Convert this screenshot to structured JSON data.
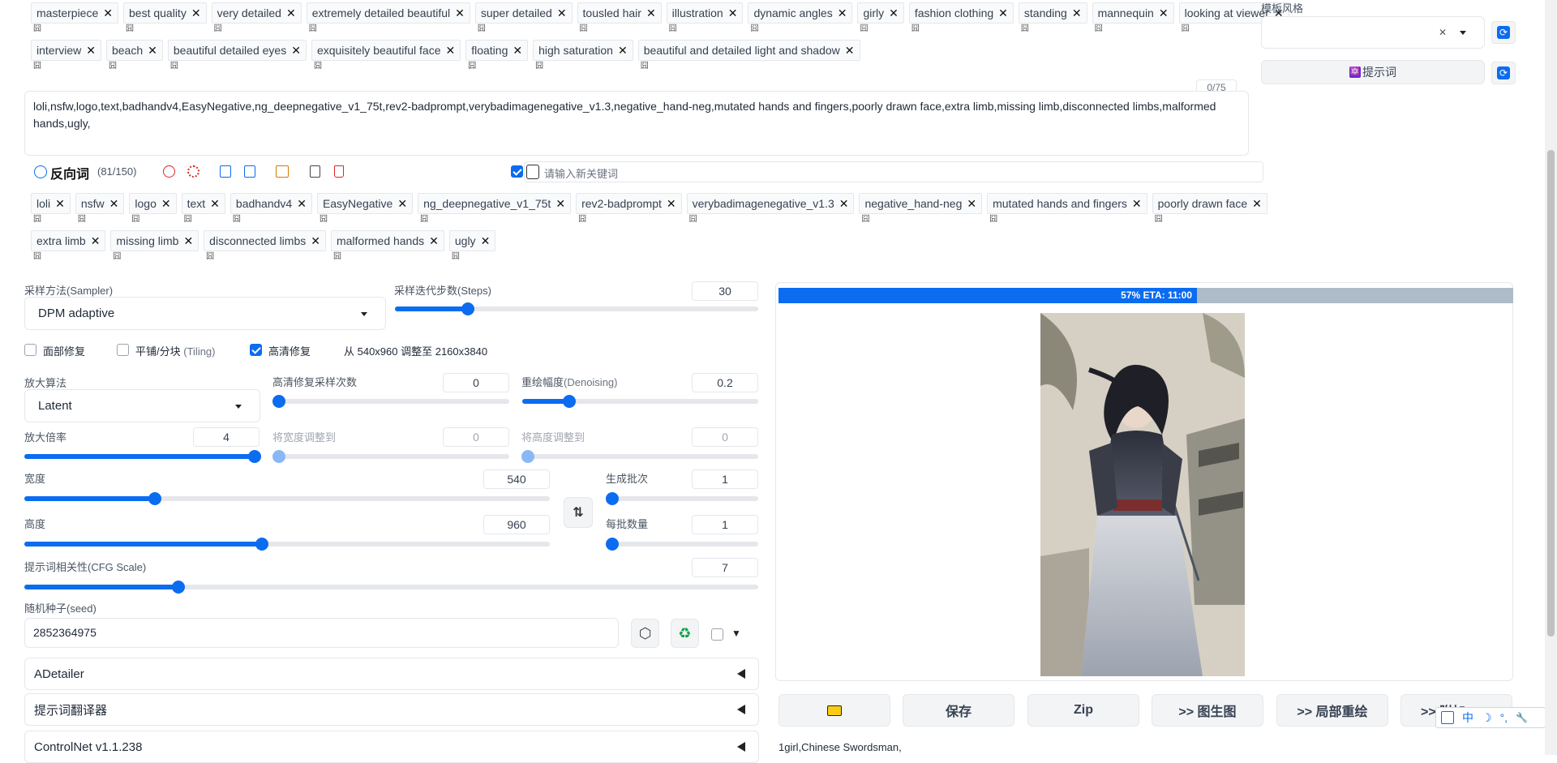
{
  "positive_tags": {
    "row1": [
      "masterpiece",
      "best quality",
      "very detailed",
      "extremely detailed beautiful",
      "super detailed",
      "tousled hair",
      "illustration",
      "dynamic angles",
      "girly",
      "fashion clothing",
      "standing",
      "mannequin",
      "looking at viewer"
    ],
    "row2": [
      "interview",
      "beach",
      "beautiful detailed eyes",
      "exquisitely beautiful face",
      "floating",
      "high saturation",
      "beautiful and detailed light and shadow"
    ],
    "sub_glyph": "囧",
    "remove_glyph": "✕"
  },
  "template": {
    "label": "模板风格",
    "clear_glyph": "✕",
    "prompt_button": "提示词",
    "prompt_icon_glyph": "🔯",
    "refresh_glyph": "⟳"
  },
  "token_counter": "0/75",
  "negative_text": "loli,nsfw,logo,text,badhandv4,EasyNegative,ng_deepnegative_v1_75t,rev2-badprompt,verybadimagenegative_v1.3,negative_hand-neg,mutated hands and fingers,poorly drawn face,extra limb,missing limb,disconnected limbs,malformed hands,ugly,",
  "negative_toolbar": {
    "title": "反向词",
    "count": "(81/150)",
    "keyword_placeholder": "请输入新关键词"
  },
  "negative_tags": {
    "row1": [
      "loli",
      "nsfw",
      "logo",
      "text",
      "badhandv4",
      "EasyNegative",
      "ng_deepnegative_v1_75t",
      "rev2-badprompt",
      "verybadimagenegative_v1.3",
      "negative_hand-neg",
      "mutated hands and fingers",
      "poorly drawn face"
    ],
    "row2": [
      "extra limb",
      "missing limb",
      "disconnected limbs",
      "malformed hands",
      "ugly"
    ]
  },
  "sampler": {
    "label": "采样方法(Sampler)",
    "value": "DPM adaptive"
  },
  "steps": {
    "label": "采样迭代步数(Steps)",
    "value": "30",
    "fraction": 0.2
  },
  "checkboxes": {
    "face_restore": "面部修复",
    "tiling": "平铺/分块",
    "tiling_en": "(Tiling)",
    "hires": "高清修复",
    "hires_info": "从 540x960 调整至 2160x3840"
  },
  "upscaler": {
    "label": "放大算法",
    "value": "Latent"
  },
  "hires_steps": {
    "label": "高清修复采样次数",
    "value": "0",
    "fraction": 0.0
  },
  "denoising": {
    "label": "重绘幅度",
    "label_en": "(Denoising)",
    "value": "0.2",
    "fraction": 0.2
  },
  "upscale_by": {
    "label": "放大倍率",
    "value": "4",
    "fraction": 1.0
  },
  "resize_w": {
    "label": "将宽度调整到",
    "value": "0",
    "fraction": 0.0
  },
  "resize_h": {
    "label": "将高度调整到",
    "value": "0",
    "fraction": 0.0
  },
  "width": {
    "label": "宽度",
    "value": "540",
    "fraction": 0.248
  },
  "height": {
    "label": "高度",
    "value": "960",
    "fraction": 0.452
  },
  "swap_glyph": "⇅",
  "batch_count": {
    "label": "生成批次",
    "value": "1",
    "fraction": 0.0
  },
  "batch_size": {
    "label": "每批数量",
    "value": "1",
    "fraction": 0.0
  },
  "cfg": {
    "label": "提示词相关性(CFG Scale)",
    "value": "7",
    "fraction": 0.21
  },
  "seed": {
    "label": "随机种子(seed)",
    "value": "2852364975",
    "dice_glyph": "⬡",
    "recycle_glyph": "♻",
    "extra_glyph": "▼"
  },
  "accordions": [
    "ADetailer",
    "提示词翻译器",
    "ControlNet v1.1.238"
  ],
  "progress": {
    "text": "57% ETA: 11:00",
    "fraction": 0.57
  },
  "output_buttons": {
    "folder_glyph": "📁",
    "save": "保存",
    "zip": "Zip",
    "img2img": ">> 图生图",
    "inpaint": ">> 局部重绘",
    "extras": ">> 附加"
  },
  "generation_info": "1girl,Chinese Swordsman,",
  "ime_toolbar": {
    "lang": "中",
    "moon": "☽",
    "dots": "°,",
    "wrench": "🔧"
  }
}
